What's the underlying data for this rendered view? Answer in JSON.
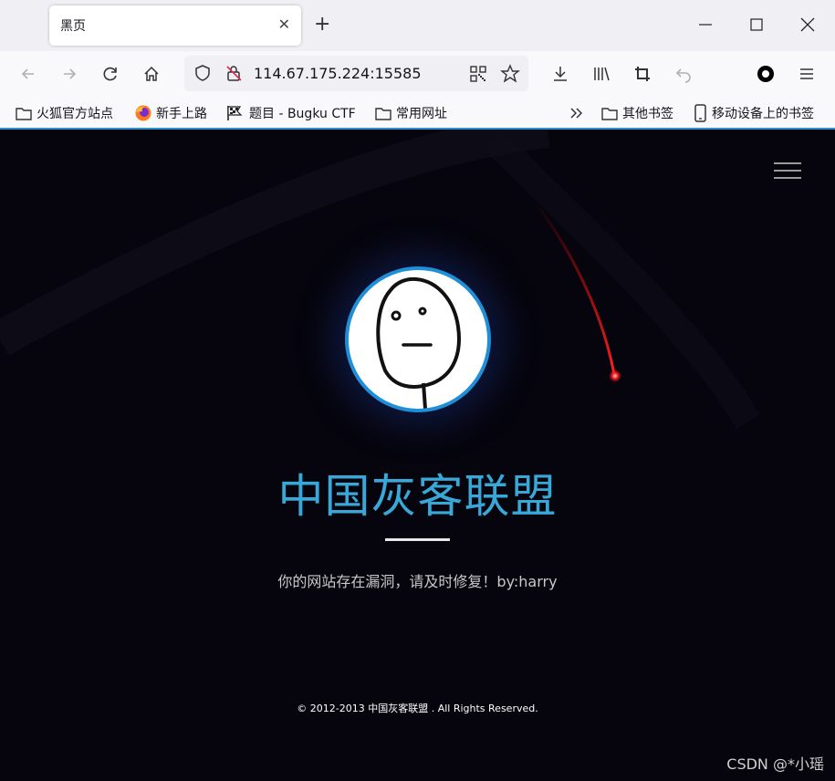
{
  "browser": {
    "tab": {
      "title": "黑页",
      "close_icon": "close-icon"
    },
    "url": "114.67.175.224:15585",
    "bookmarks": [
      {
        "label": "火狐官方站点",
        "icon": "folder-icon"
      },
      {
        "label": "新手上路",
        "icon": "firefox-icon"
      },
      {
        "label": "题目 - Bugku CTF",
        "icon": "flag-icon"
      },
      {
        "label": "常用网址",
        "icon": "folder-icon"
      },
      {
        "label": "其他书签",
        "icon": "folder-icon"
      },
      {
        "label": "移动设备上的书签",
        "icon": "mobile-icon"
      }
    ]
  },
  "page": {
    "title": "中国灰客联盟",
    "subtitle": "你的网站存在漏洞，请及时修复！by:harry",
    "footer": "© 2012-2013 中国灰客联盟 . All Rights Reserved.",
    "watermark": "CSDN @*小瑶"
  },
  "colors": {
    "page_background": "#06050d",
    "title": "#38a8d8",
    "avatar_border": "#1f8fd8",
    "meteor": "#ff2020"
  }
}
